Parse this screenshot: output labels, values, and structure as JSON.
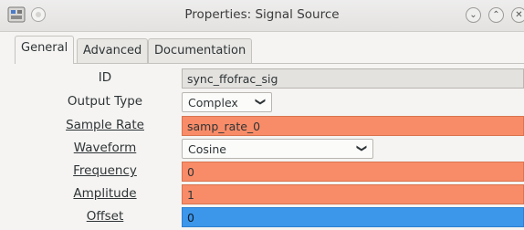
{
  "window": {
    "title": "Properties: Signal Source"
  },
  "tabs": [
    {
      "label": "General",
      "active": true
    },
    {
      "label": "Advanced",
      "active": false
    },
    {
      "label": "Documentation",
      "active": false
    }
  ],
  "rows": {
    "id": {
      "label": "ID",
      "value": "sync_ffofrac_sig"
    },
    "output_type": {
      "label": "Output Type",
      "value": "Complex"
    },
    "sample_rate": {
      "label": "Sample Rate",
      "value": "samp_rate_0"
    },
    "waveform": {
      "label": "Waveform",
      "value": "Cosine"
    },
    "frequency": {
      "label": "Frequency",
      "value": "0"
    },
    "amplitude": {
      "label": "Amplitude",
      "value": "1"
    },
    "offset": {
      "label": "Offset",
      "value": "0"
    }
  },
  "colors": {
    "complex_field": "#f98c68",
    "float_field": "#3c96ea"
  }
}
